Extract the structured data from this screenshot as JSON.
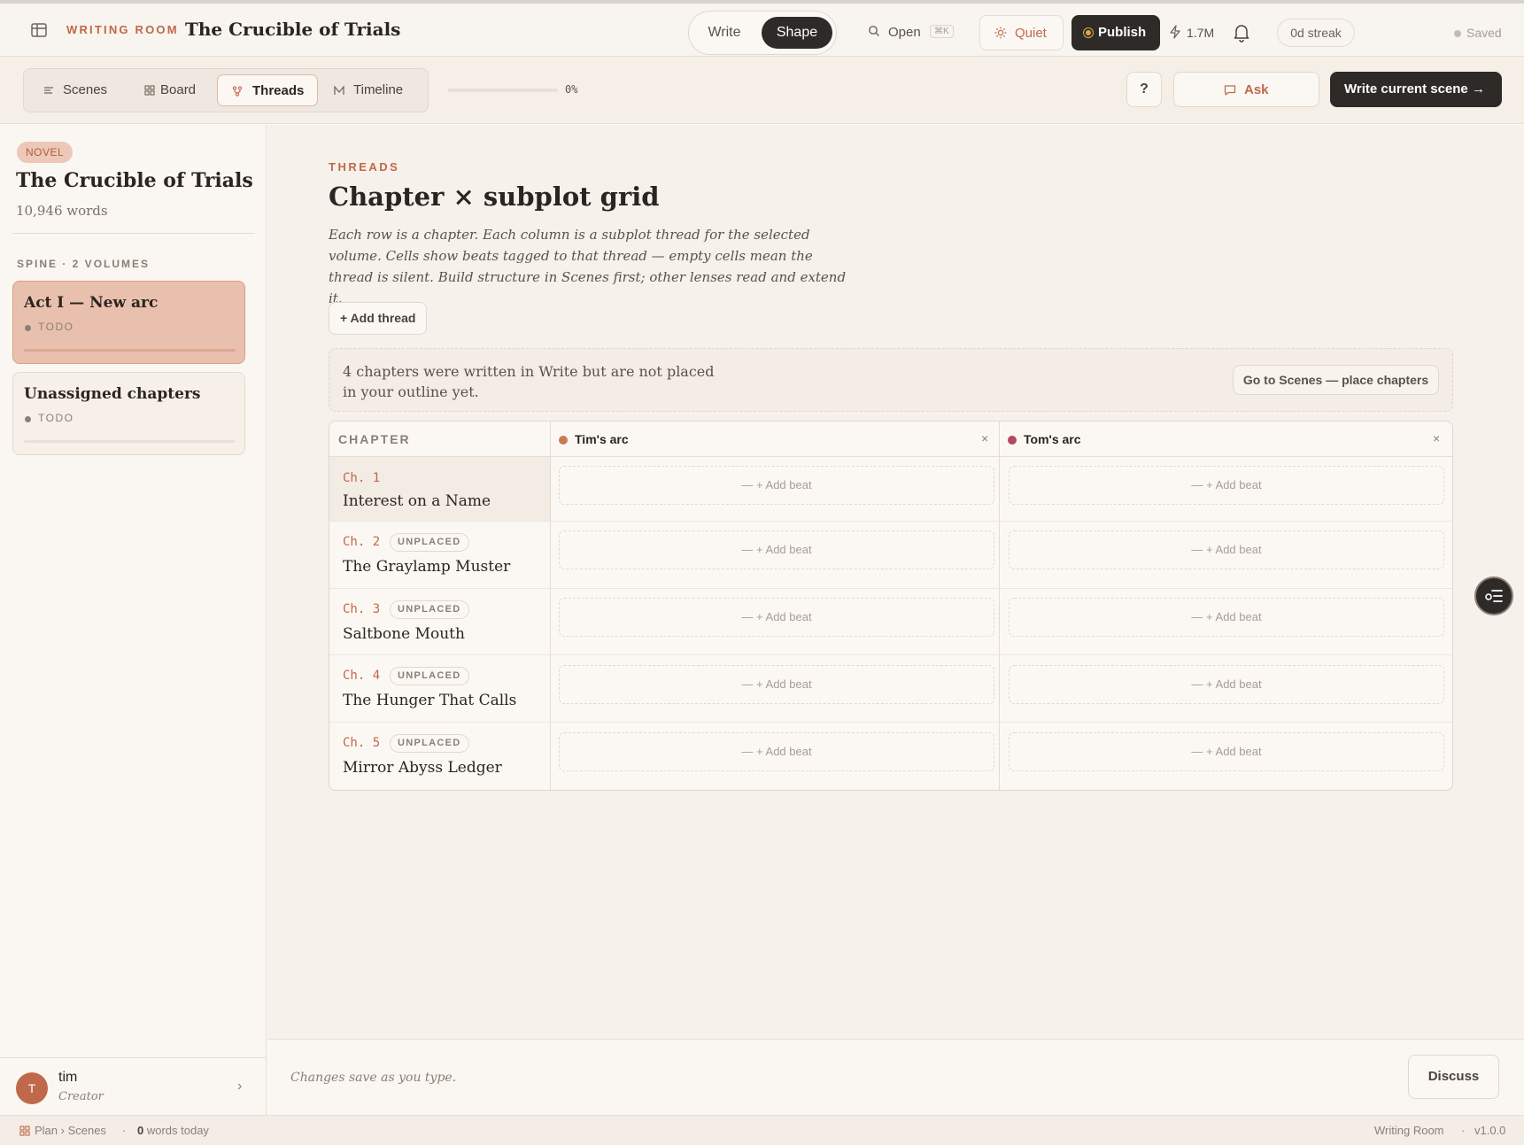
{
  "topbar": {
    "brand": "WRITING ROOM",
    "title": "The Crucible of Trials",
    "mode_write": "Write",
    "mode_shape": "Shape",
    "open_label": "Open",
    "open_shortcut": "⌘K",
    "quiet_label": "Quiet",
    "publish_label": "Publish",
    "tokens": "1.7M",
    "streak": "0d streak",
    "saved": "Saved"
  },
  "lenses": {
    "scenes": "Scenes",
    "board": "Board",
    "threads": "Threads",
    "timeline": "Timeline",
    "progress_pct": "0%",
    "progress_value": 0
  },
  "actions": {
    "help": "?",
    "ask": "Ask",
    "write_current": "Write current scene →"
  },
  "sidebar": {
    "badge": "NOVEL",
    "title": "The Crucible of Trials",
    "words": "10,946 words",
    "spine_label": "SPINE · 2 VOLUMES",
    "volumes": [
      {
        "title": "Act I — New arc",
        "status": "TODO"
      },
      {
        "title": "Unassigned chapters",
        "status": "TODO"
      }
    ],
    "user": {
      "initial": "T",
      "name": "tim",
      "role": "Creator"
    }
  },
  "main": {
    "eyebrow": "THREADS",
    "heading": "Chapter × subplot grid",
    "description": "Each row is a chapter. Each column is a subplot thread for the selected volume. Cells show beats tagged to that thread — empty cells mean the thread is silent. Build structure in Scenes first; other lenses read and extend it.",
    "add_thread": "+ Add thread",
    "notice_text": "4 chapters were written in Write but are not placed in your outline yet.",
    "notice_button": "Go to Scenes — place chapters",
    "chapter_header": "CHAPTER",
    "threads": [
      {
        "name": "Tim's arc",
        "color": "#c97b52",
        "close": "×"
      },
      {
        "name": "Tom's arc",
        "color": "#b04a5e",
        "close": "×"
      }
    ],
    "add_beat": "— + Add beat",
    "chapters": [
      {
        "num": "Ch. 1",
        "title": "Interest on a Name",
        "badge": ""
      },
      {
        "num": "Ch. 2",
        "title": "The Graylamp Muster",
        "badge": "UNPLACED"
      },
      {
        "num": "Ch. 3",
        "title": "Saltbone Mouth",
        "badge": "UNPLACED"
      },
      {
        "num": "Ch. 4",
        "title": "The Hunger That Calls",
        "badge": "UNPLACED"
      },
      {
        "num": "Ch. 5",
        "title": "Mirror Abyss Ledger",
        "badge": "UNPLACED"
      }
    ]
  },
  "footer": {
    "note": "Changes save as you type.",
    "discuss": "Discuss"
  },
  "statusbar": {
    "crumb": "Plan › Scenes",
    "sep": "·",
    "words_num": "0",
    "words_label": " words today",
    "app": "Writing Room",
    "version": "v1.0.0"
  },
  "colors": {
    "accent": "#c0684a",
    "dark": "#2e2a27",
    "background": "#faf6f1"
  }
}
